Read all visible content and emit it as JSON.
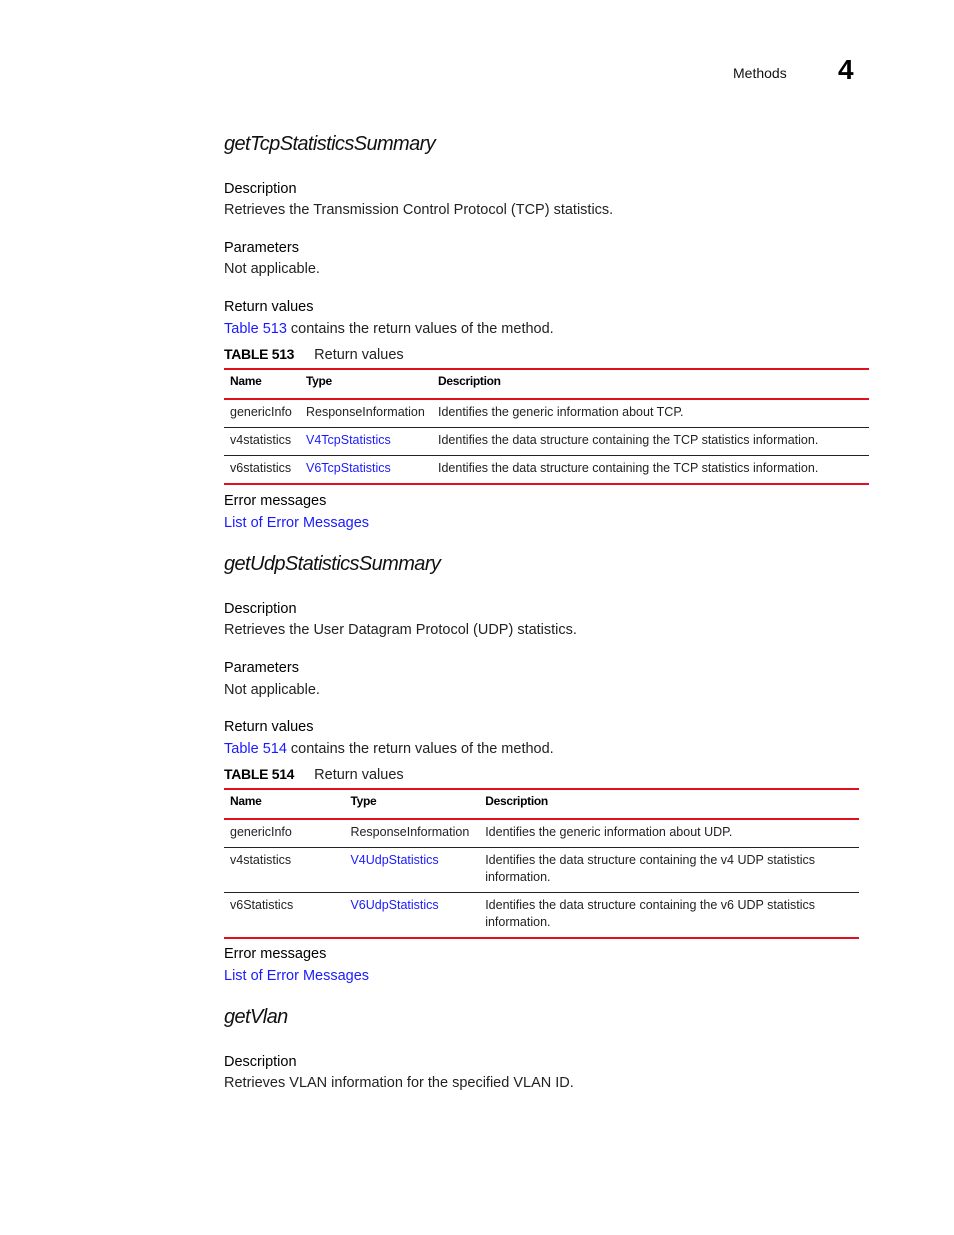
{
  "header": {
    "section": "Methods",
    "chapter": "4"
  },
  "sections": [
    {
      "title": "getTcpStatisticsSummary",
      "description_label": "Description",
      "description": "Retrieves the Transmission Control Protocol (TCP) statistics.",
      "parameters_label": "Parameters",
      "parameters": "Not applicable.",
      "return_label": "Return values",
      "return_link": "Table 513",
      "return_text": " contains the return values of the method.",
      "table": {
        "number": "TABLE 513",
        "caption": "Return values",
        "headers": [
          "Name",
          "Type",
          "Description"
        ],
        "rows": [
          {
            "name": "genericInfo",
            "type": "ResponseInformation",
            "type_link": false,
            "description": "Identifies the generic information about TCP."
          },
          {
            "name": "v4statistics",
            "type": "V4TcpStatistics",
            "type_link": true,
            "description": "Identifies the data structure containing the TCP statistics information."
          },
          {
            "name": "v6statistics",
            "type": "V6TcpStatistics",
            "type_link": true,
            "description": "Identifies the data structure containing the TCP statistics information."
          }
        ]
      },
      "errors_label": "Error messages",
      "errors_link": "List of Error Messages"
    },
    {
      "title": "getUdpStatisticsSummary",
      "description_label": "Description",
      "description": "Retrieves the User Datagram Protocol (UDP) statistics.",
      "parameters_label": "Parameters",
      "parameters": "Not applicable.",
      "return_label": "Return values",
      "return_link": "Table 514",
      "return_text": " contains the return values of the method.",
      "table": {
        "number": "TABLE 514",
        "caption": "Return values",
        "headers": [
          "Name",
          "Type",
          "Description"
        ],
        "rows": [
          {
            "name": "genericInfo",
            "type": "ResponseInformation",
            "type_link": false,
            "description": "Identifies the generic information about UDP."
          },
          {
            "name": "v4statistics",
            "type": "V4UdpStatistics",
            "type_link": true,
            "description": "Identifies the data structure containing the v4 UDP statistics information."
          },
          {
            "name": "v6Statistics",
            "type": "V6UdpStatistics",
            "type_link": true,
            "description": "Identifies the data structure containing the v6 UDP statistics information."
          }
        ]
      },
      "errors_label": "Error messages",
      "errors_link": "List of Error Messages"
    },
    {
      "title": "getVlan",
      "description_label": "Description",
      "description": "Retrieves VLAN information for the specified VLAN ID."
    }
  ],
  "colors": {
    "link": "#1a1aff",
    "rule": "#e0101e"
  }
}
